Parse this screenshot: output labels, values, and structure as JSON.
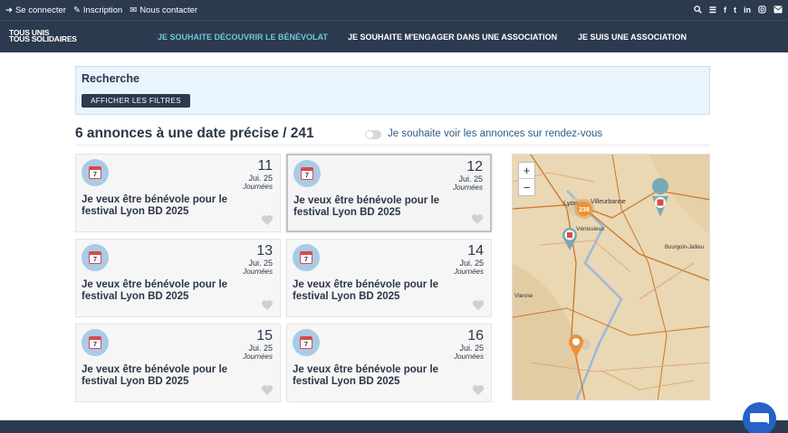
{
  "topbar": {
    "login": "Se connecter",
    "register": "Inscription",
    "contact": "Nous contacter",
    "social": [
      "f",
      "t",
      "in"
    ]
  },
  "nav": {
    "logo_line1": "TOUS UNIS",
    "logo_line2": "TOUS SOLIDAIRES",
    "links": [
      "JE SOUHAITE DÉCOUVRIR LE BÉNÉVOLAT",
      "JE SOUHAITE M'ENGAGER DANS UNE ASSOCIATION",
      "JE SUIS UNE ASSOCIATION"
    ],
    "active_color": "#6fc6d6"
  },
  "search": {
    "title": "Recherche",
    "filters_button": "AFFICHER LES FILTRES"
  },
  "results": {
    "title": "6 annonces à une date précise / 241",
    "toggle_label": "Je souhaite voir les annonces sur rendez-vous"
  },
  "cards": [
    {
      "day": "11",
      "month": "Jui. 25",
      "duration": "Journées",
      "title": "Je veux être bénévole pour le festival Lyon BD 2025",
      "cal": "7"
    },
    {
      "day": "12",
      "month": "Jui. 25",
      "duration": "Journées",
      "title": "Je veux être bénévole pour le festival Lyon BD 2025",
      "cal": "7"
    },
    {
      "day": "13",
      "month": "Jui. 25",
      "duration": "Journées",
      "title": "Je veux être bénévole pour le festival Lyon BD 2025",
      "cal": "7"
    },
    {
      "day": "14",
      "month": "Jui. 25",
      "duration": "Journées",
      "title": "Je veux être bénévole pour le festival Lyon BD 2025",
      "cal": "7"
    },
    {
      "day": "15",
      "month": "Jui. 25",
      "duration": "Journées",
      "title": "Je veux être bénévole pour le festival Lyon BD 2025",
      "cal": "7"
    },
    {
      "day": "16",
      "month": "Jui. 25",
      "duration": "Journées",
      "title": "Je veux être bénévole pour le festival Lyon BD 2025",
      "cal": "7"
    }
  ],
  "map": {
    "zoom_in": "+",
    "zoom_out": "−",
    "cluster_count": "238",
    "labels": [
      "Lyon",
      "Villeurbanne",
      "Vénissieux",
      "Bourgoin-Jallieu",
      "Vienne"
    ],
    "cluster_color": "#e8923a",
    "marker_color": "#7aa8b4"
  },
  "colors": {
    "header": "#2c3a4f",
    "accent": "#6fc6d6",
    "panel": "#eaf4fc",
    "chat": "#2561c7"
  }
}
